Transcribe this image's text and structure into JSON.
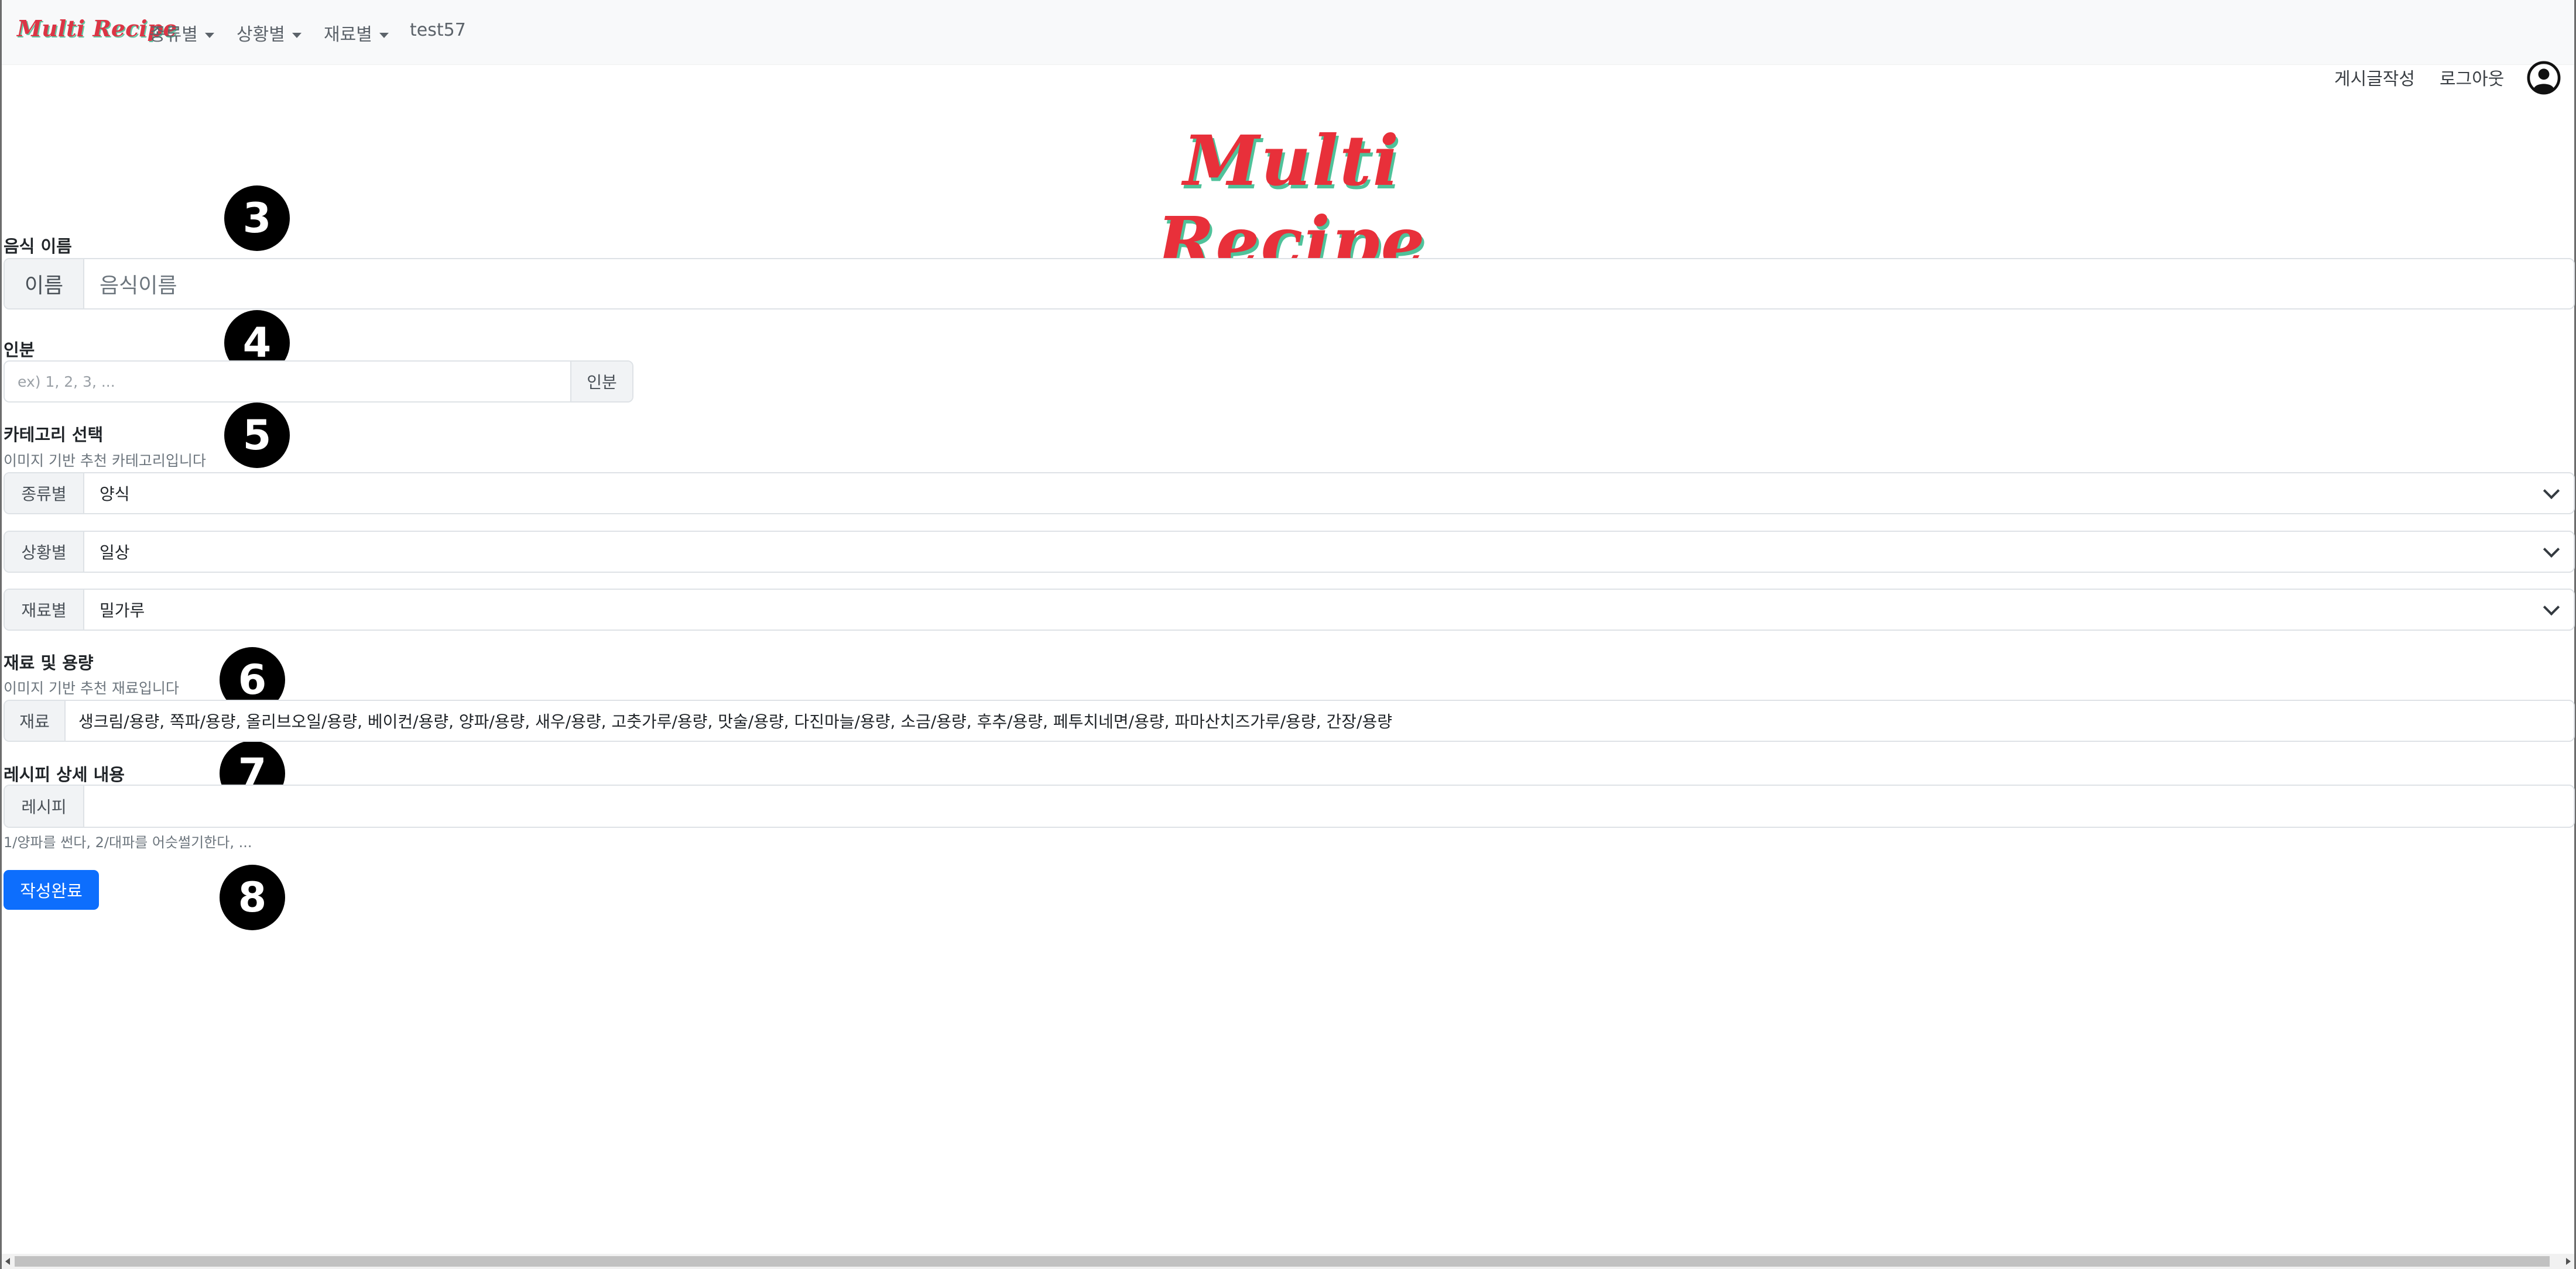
{
  "navbar": {
    "brand": "Multi Recipe",
    "menu": [
      {
        "label": "종류별"
      },
      {
        "label": "상황별"
      },
      {
        "label": "재료별"
      }
    ],
    "user": "test57"
  },
  "top_links": {
    "write": "게시글작성",
    "logout": "로그아웃"
  },
  "hero": "Multi Recipe",
  "markers": [
    "3",
    "4",
    "5",
    "6",
    "7",
    "8"
  ],
  "form": {
    "name": {
      "label": "음식 이름",
      "addon": "이름",
      "placeholder": "음식이름"
    },
    "servings": {
      "label": "인분",
      "placeholder": "ex) 1, 2, 3, ...",
      "addon": "인분"
    },
    "category": {
      "label": "카테고리 선택",
      "note": "이미지 기반 추천 카테고리입니다",
      "selects": [
        {
          "addon": "종류별",
          "value": "양식"
        },
        {
          "addon": "상황별",
          "value": "일상"
        },
        {
          "addon": "재료별",
          "value": "밀가루"
        }
      ]
    },
    "ingredients": {
      "label": "재료 및 용량",
      "note": "이미지 기반 추천 재료입니다",
      "addon": "재료",
      "value": "생크림/용량, 쪽파/용량, 올리브오일/용량, 베이컨/용량, 양파/용량, 새우/용량, 고춧가루/용량, 맛술/용량, 다진마늘/용량, 소금/용량, 후추/용량, 페투치네면/용량, 파마산치즈가루/용량, 간장/용량"
    },
    "recipe": {
      "label": "레시피 상세 내용",
      "addon": "레시피",
      "hint": "1/양파를 썬다, 2/대파를 어슷썰기한다, ..."
    },
    "submit": "작성완료"
  }
}
